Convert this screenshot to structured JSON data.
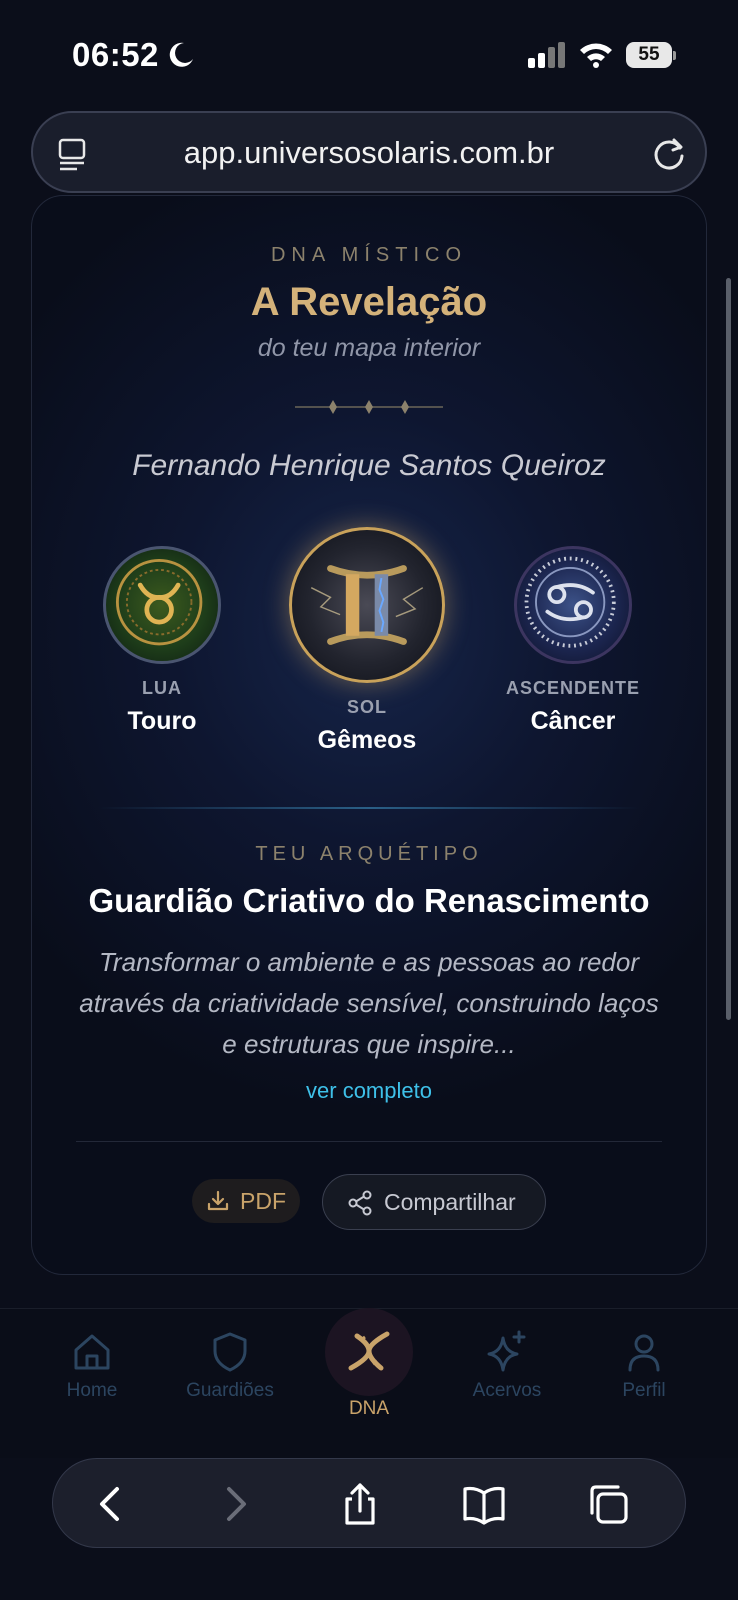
{
  "status": {
    "time": "06:52",
    "battery": "55"
  },
  "browser": {
    "url": "app.universosolaris.com.br"
  },
  "header": {
    "eyebrow": "DNA MÍSTICO",
    "title": "A Revelação",
    "subtitle": "do teu mapa interior",
    "person_name": "Fernando Henrique Santos Queiroz"
  },
  "signs": {
    "moon": {
      "role": "LUA",
      "name": "Touro",
      "accent": "#1f6a3a"
    },
    "sun": {
      "role": "SOL",
      "name": "Gêmeos",
      "accent": "#d4a860"
    },
    "ascendant": {
      "role": "ASCENDENTE",
      "name": "Câncer",
      "accent": "#2c3f74"
    }
  },
  "archetype": {
    "eyebrow": "TEU ARQUÉTIPO",
    "title": "Guardião Criativo do Renascimento",
    "description": "Transformar o ambiente e as pessoas ao redor através da criatividade sensível, construindo laços e estruturas que inspire...",
    "more_link": "ver completo"
  },
  "actions": {
    "pdf": "PDF",
    "share": "Compartilhar"
  },
  "nav": {
    "home": "Home",
    "guardians": "Guardiões",
    "dna": "DNA",
    "collections": "Acervos",
    "profile": "Perfil"
  },
  "colors": {
    "gold": "#d4b27a",
    "link": "#3ec0e8",
    "nav_inactive": "#2c4560",
    "nav_active": "#c9a36a"
  }
}
